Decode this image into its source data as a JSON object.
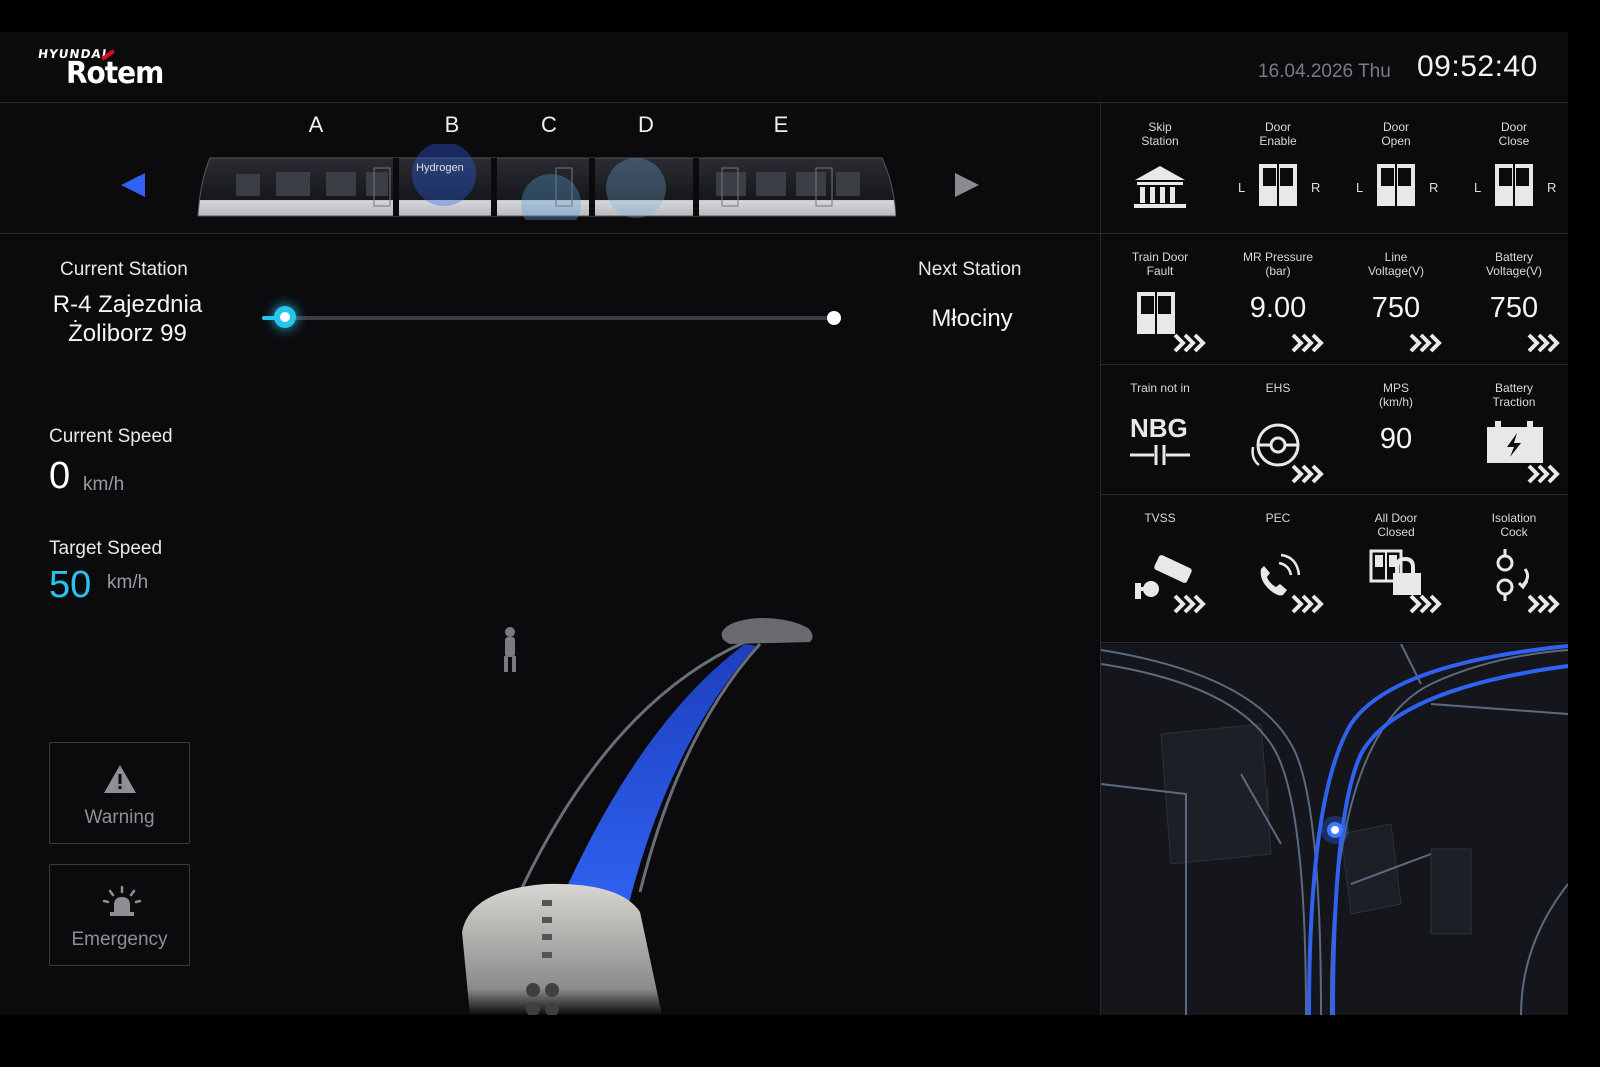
{
  "header": {
    "brand_top": "HYUNDAI",
    "brand_main": "Rotem",
    "date": "16.04.2026 Thu",
    "time": "09:52:40"
  },
  "train": {
    "cars": [
      "A",
      "B",
      "C",
      "D",
      "E"
    ],
    "livery_text": "Hydrogen",
    "prev_icon": "triangle-left-icon",
    "next_icon": "triangle-right-icon"
  },
  "route": {
    "current_label": "Current Station",
    "current_station": "R-4 Zajezdnia\nŻoliborz 99",
    "next_label": "Next Station",
    "next_station": "Młociny",
    "progress_fraction": 0.04
  },
  "speed": {
    "current_label": "Current Speed",
    "current_value": "0",
    "current_unit": "km/h",
    "target_label": "Target Speed",
    "target_value": "50",
    "target_unit": "km/h"
  },
  "buttons": {
    "warning": "Warning",
    "emergency": "Emergency"
  },
  "status_grid": [
    {
      "title": "Skip\nStation",
      "icon": "station-building-icon"
    },
    {
      "title": "Door\nEnable",
      "icon": "door-lr-icon",
      "left": "L",
      "right": "R"
    },
    {
      "title": "Door\nOpen",
      "icon": "door-lr-icon",
      "left": "L",
      "right": "R"
    },
    {
      "title": "Door\nClose",
      "icon": "door-lr-icon",
      "left": "L",
      "right": "R"
    },
    {
      "title": "Train Door\nFault",
      "icon": "door-fault-icon"
    },
    {
      "title": "MR Pressure\n(bar)",
      "value": "9.00"
    },
    {
      "title": "Line\nVoltage(V)",
      "value": "750"
    },
    {
      "title": "Battery\nVoltage(V)",
      "value": "750"
    },
    {
      "title": "Train not in",
      "icon": "nbg-icon",
      "icon_text": "NBG"
    },
    {
      "title": "EHS",
      "icon": "ehs-icon"
    },
    {
      "title": "MPS\n(km/h)",
      "value": "90"
    },
    {
      "title": "Battery\nTraction",
      "icon": "battery-icon"
    },
    {
      "title": "TVSS",
      "icon": "cctv-camera-icon"
    },
    {
      "title": "PEC",
      "icon": "phone-call-icon"
    },
    {
      "title": "All Door\nClosed",
      "icon": "door-lock-icon"
    },
    {
      "title": "Isolation\nCock",
      "icon": "isolation-cock-icon"
    }
  ],
  "colors": {
    "accent_cyan": "#27c4ee",
    "route_blue": "#2f62f0",
    "background": "#0b0b0e"
  }
}
